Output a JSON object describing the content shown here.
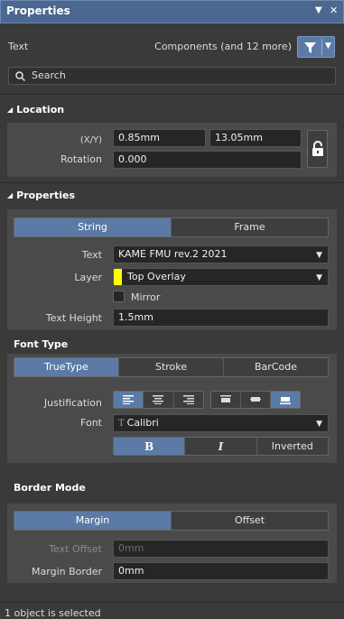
{
  "panel": {
    "title": "Properties",
    "pin_icon": "chevron-down-icon",
    "close_icon": "close-icon"
  },
  "filter": {
    "object_type": "Text",
    "scope_text": "Components (and 12 more)",
    "filter_icon": "funnel-icon"
  },
  "search": {
    "placeholder": "Search"
  },
  "location": {
    "header": "Location",
    "xy_label": "(X/Y)",
    "x_value": "0.85mm",
    "y_value": "13.05mm",
    "rotation_label": "Rotation",
    "rotation_value": "0.000",
    "lock_icon": "lock-icon"
  },
  "properties": {
    "header": "Properties",
    "mode_tabs": [
      "String",
      "Frame"
    ],
    "text_label": "Text",
    "text_value": "KAME FMU rev.2 2021",
    "layer_label": "Layer",
    "layer_value": "Top Overlay",
    "layer_color": "#ffff00",
    "mirror_label": "Mirror",
    "text_height_label": "Text Height",
    "text_height_value": "1.5mm"
  },
  "font_type": {
    "header": "Font Type",
    "options": [
      "TrueType",
      "Stroke",
      "BarCode"
    ],
    "justification_label": "Justification",
    "font_label": "Font",
    "font_value": "Calibri",
    "style_options": [
      "B",
      "I",
      "Inverted"
    ]
  },
  "border_mode": {
    "header": "Border Mode",
    "options": [
      "Margin",
      "Offset"
    ],
    "text_offset_label": "Text Offset",
    "text_offset_value": "0mm",
    "margin_border_label": "Margin Border",
    "margin_border_value": "0mm"
  },
  "status": {
    "text": "1 object is selected"
  },
  "colors": {
    "accent": "#5b7ba6",
    "title_bar": "#4a6890",
    "panel_bg": "#3a3a3a"
  }
}
